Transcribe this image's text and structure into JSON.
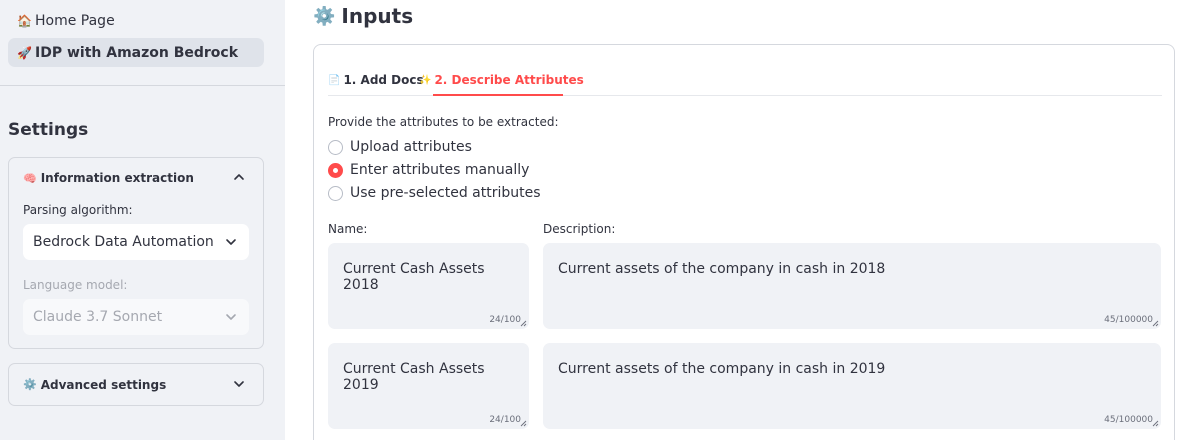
{
  "sidebar": {
    "nav": [
      {
        "icon": "house-icon",
        "emoji": "🏠",
        "label": "Home Page"
      },
      {
        "icon": "rocket-icon",
        "emoji": "🚀",
        "label": "IDP with Amazon Bedrock"
      }
    ],
    "settings_title": "Settings",
    "info_extraction": {
      "emoji": "🧠",
      "title": "Information extraction",
      "parsing_label": "Parsing algorithm:",
      "parsing_value": "Bedrock Data Automation",
      "model_label": "Language model:",
      "model_value": "Claude 3.7 Sonnet"
    },
    "advanced": {
      "emoji": "⚙️",
      "title": "Advanced settings"
    }
  },
  "main": {
    "title_emoji": "⚙️",
    "title": "Inputs",
    "tabs": [
      {
        "emoji": "📄",
        "label": "1. Add Docs"
      },
      {
        "emoji": "✨",
        "label": "2. Describe Attributes"
      }
    ],
    "prompt": "Provide the attributes to be extracted:",
    "radios": [
      {
        "label": "Upload attributes",
        "checked": false
      },
      {
        "label": "Enter attributes manually",
        "checked": true
      },
      {
        "label": "Use pre-selected attributes",
        "checked": false
      }
    ],
    "name_label": "Name:",
    "description_label": "Description:",
    "rows": [
      {
        "name": "Current Cash Assets 2018",
        "name_count": "24/100",
        "description": "Current assets of the company in cash in 2018",
        "description_count": "45/100000"
      },
      {
        "name": "Current Cash Assets 2019",
        "name_count": "24/100",
        "description": "Current assets of the company in cash in 2019",
        "description_count": "45/100000"
      }
    ]
  },
  "colors": {
    "accent": "#ff4b4b",
    "sidebar_bg": "#f0f2f6",
    "text": "#31333f"
  }
}
